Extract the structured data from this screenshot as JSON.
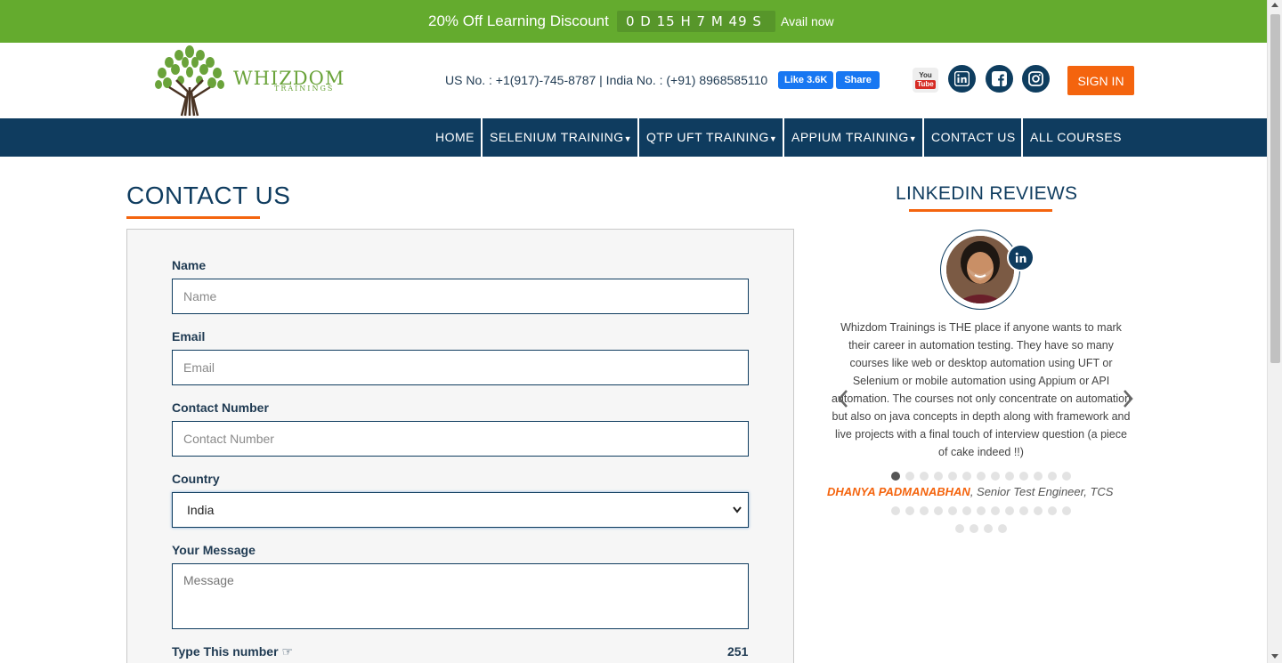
{
  "promo": {
    "text": "20% Off Learning Discount",
    "countdown": "0 D  15 H  7 M  49 S",
    "avail": "Avail now"
  },
  "header": {
    "logo_word": "WHIZDOM",
    "logo_sub": "TRAININGS",
    "phones": "US No. : +1(917)-745-8787 | India No. : (+91) 8968585110",
    "fb_like": "Like 3.6K",
    "fb_share": "Share",
    "yt_top": "You",
    "yt_bottom": "Tube",
    "signin": "SIGN IN"
  },
  "nav": {
    "items": [
      {
        "label": "HOME"
      },
      {
        "label": "SELENIUM TRAINING"
      },
      {
        "label": "QTP UFT TRAINING"
      },
      {
        "label": "APPIUM TRAINING"
      },
      {
        "label": "CONTACT US"
      },
      {
        "label": "ALL COURSES"
      }
    ]
  },
  "contact": {
    "title": "CONTACT US",
    "fields": {
      "name_label": "Name",
      "name_placeholder": "Name",
      "email_label": "Email",
      "email_placeholder": "Email",
      "phone_label": "Contact Number",
      "phone_placeholder": "Contact Number",
      "country_label": "Country",
      "country_value": "India",
      "message_label": "Your Message",
      "message_placeholder": "Message",
      "captcha_label": "Type This number",
      "captcha_value": "251"
    }
  },
  "reviews": {
    "title": "LINKEDIN REVIEWS",
    "text": "Whizdom Trainings is THE place if anyone wants to mark their career in automation testing. They have so many courses like web or desktop automation using UFT or Selenium or mobile automation using Appium or API automation. The courses not only concentrate on automation but also on java concepts in depth along with framework and live projects with a final touch of interview question (a piece of cake indeed !!)",
    "reviewer_name": "DHANYA PADMANABHAN",
    "reviewer_role": ", Senior Test Engineer, TCS",
    "dot_rows": [
      13,
      13,
      4
    ],
    "active_dot": 0
  },
  "colors": {
    "promo_green": "#64ab2e",
    "navy": "#0f3c5f",
    "accent_orange": "#f4640e"
  }
}
